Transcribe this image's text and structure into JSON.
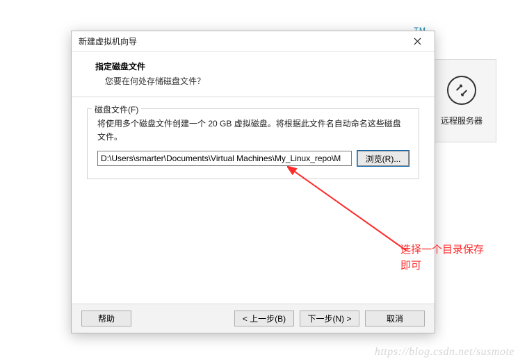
{
  "tm_mark": "TM",
  "bg_card": {
    "label": "远程服务器"
  },
  "dialog": {
    "title": "新建虚拟机向导",
    "header": {
      "title": "指定磁盘文件",
      "subtitle": "您要在何处存储磁盘文件？"
    },
    "fieldset_label": "磁盘文件(F)",
    "description": "将使用多个磁盘文件创建一个 20 GB 虚拟磁盘。将根据此文件名自动命名这些磁盘文件。",
    "path_value": "D:\\Users\\smarter\\Documents\\Virtual Machines\\My_Linux_repo\\M",
    "browse_label": "浏览(R)..."
  },
  "footer": {
    "help": "帮助",
    "back": "< 上一步(B)",
    "next": "下一步(N) >",
    "cancel": "取消"
  },
  "annotation": {
    "line1": "选择一个目录保存",
    "line2": "即可"
  },
  "watermark": "https://blog.csdn.net/susmote"
}
